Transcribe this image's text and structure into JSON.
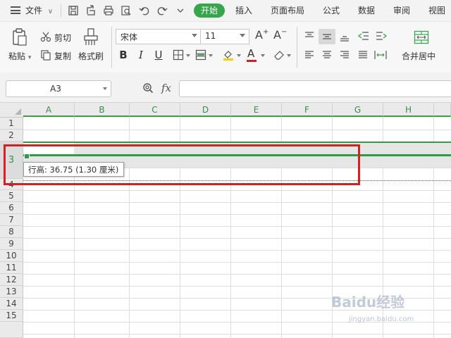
{
  "menubar": {
    "file_label": "文件",
    "tabs": [
      "开始",
      "插入",
      "页面布局",
      "公式",
      "数据",
      "审阅",
      "视图"
    ]
  },
  "ribbon": {
    "paste_label": "粘贴",
    "cut_label": "剪切",
    "copy_label": "复制",
    "format_painter_label": "格式刷",
    "font_name": "宋体",
    "font_size": "11",
    "bold": "B",
    "italic": "I",
    "underline": "U",
    "merge_center_label": "合并居中",
    "font_color_letter": "A",
    "grow_font": "A",
    "shrink_font": "A",
    "font_color": "#d42020",
    "highlight_color": "#f5d000"
  },
  "formula_bar": {
    "cell_ref": "A3",
    "fx_label": "fx",
    "formula": ""
  },
  "sheet": {
    "columns": [
      "A",
      "B",
      "C",
      "D",
      "E",
      "F",
      "G",
      "H"
    ],
    "rows": [
      "1",
      "2",
      "3",
      "4",
      "5",
      "6",
      "7",
      "8",
      "9",
      "10",
      "11",
      "12",
      "13",
      "14",
      "15"
    ],
    "tooltip": "行高: 36.75 (1.30 厘米)",
    "accent_color": "#2f9b44"
  },
  "watermark": {
    "logo_text": "Baidu经验",
    "url": "jingyan.baidu.com"
  }
}
